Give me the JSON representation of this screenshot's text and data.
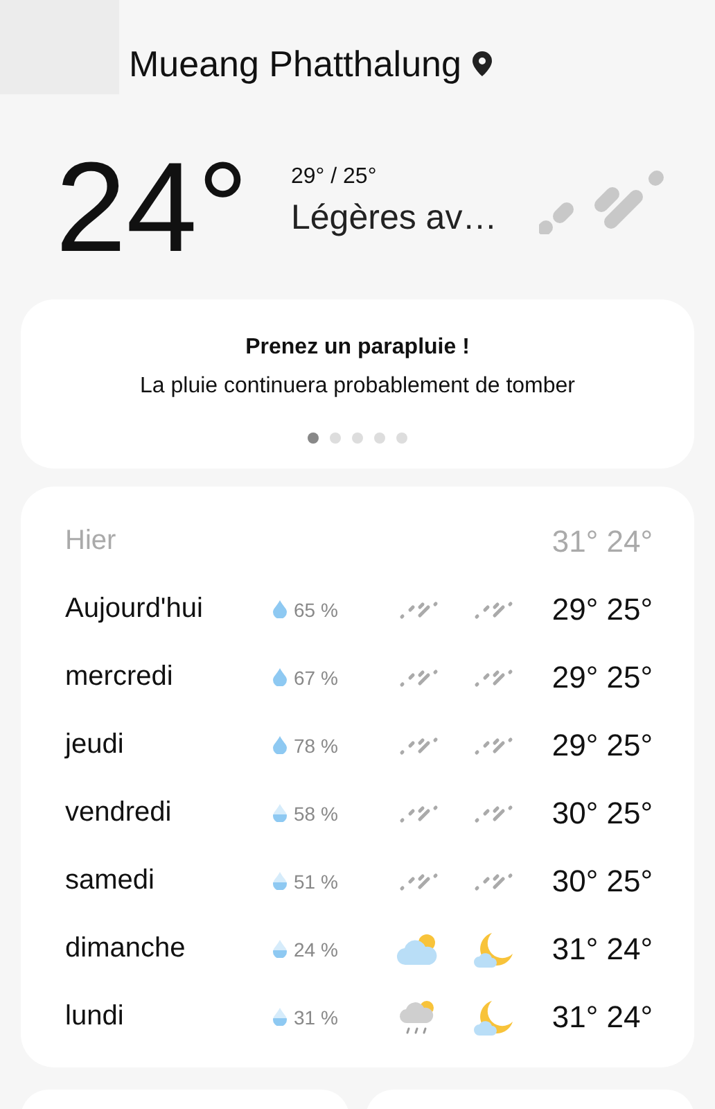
{
  "location": "Mueang Phatthalung",
  "current": {
    "temp": "24°",
    "high_low": "29° / 25°",
    "condition": "Légères av…"
  },
  "tip": {
    "title": "Prenez un parapluie !",
    "text": "La pluie continuera probablement de tomber",
    "dots": [
      {
        "selected": true
      },
      {
        "selected": false
      },
      {
        "selected": false
      },
      {
        "selected": false
      },
      {
        "selected": false
      }
    ]
  },
  "forecast": [
    {
      "day": "Hier",
      "past": true,
      "temps": "31° 24°"
    },
    {
      "day": "Aujourd'hui",
      "past": false,
      "drop": {
        "kind": "full"
      },
      "rain": "65 %",
      "day_icon": {
        "kind": "rain"
      },
      "night_icon": {
        "kind": "rain"
      },
      "temps": "29° 25°"
    },
    {
      "day": "mercredi",
      "past": false,
      "drop": {
        "kind": "full"
      },
      "rain": "67 %",
      "day_icon": {
        "kind": "rain"
      },
      "night_icon": {
        "kind": "rain"
      },
      "temps": "29° 25°"
    },
    {
      "day": "jeudi",
      "past": false,
      "drop": {
        "kind": "full"
      },
      "rain": "78 %",
      "day_icon": {
        "kind": "rain"
      },
      "night_icon": {
        "kind": "rain"
      },
      "temps": "29° 25°"
    },
    {
      "day": "vendredi",
      "past": false,
      "drop": {
        "kind": "half"
      },
      "rain": "58 %",
      "day_icon": {
        "kind": "rain"
      },
      "night_icon": {
        "kind": "rain"
      },
      "temps": "30° 25°"
    },
    {
      "day": "samedi",
      "past": false,
      "drop": {
        "kind": "half"
      },
      "rain": "51 %",
      "day_icon": {
        "kind": "rain"
      },
      "night_icon": {
        "kind": "rain"
      },
      "temps": "30° 25°"
    },
    {
      "day": "dimanche",
      "past": false,
      "drop": {
        "kind": "half"
      },
      "rain": "24 %",
      "day_icon": {
        "kind": "cloud-sun"
      },
      "night_icon": {
        "kind": "moon"
      },
      "temps": "31° 24°"
    },
    {
      "day": "lundi",
      "past": false,
      "drop": {
        "kind": "half"
      },
      "rain": "31 %",
      "day_icon": {
        "kind": "rain-sun"
      },
      "night_icon": {
        "kind": "moon"
      },
      "temps": "31° 24°"
    }
  ]
}
